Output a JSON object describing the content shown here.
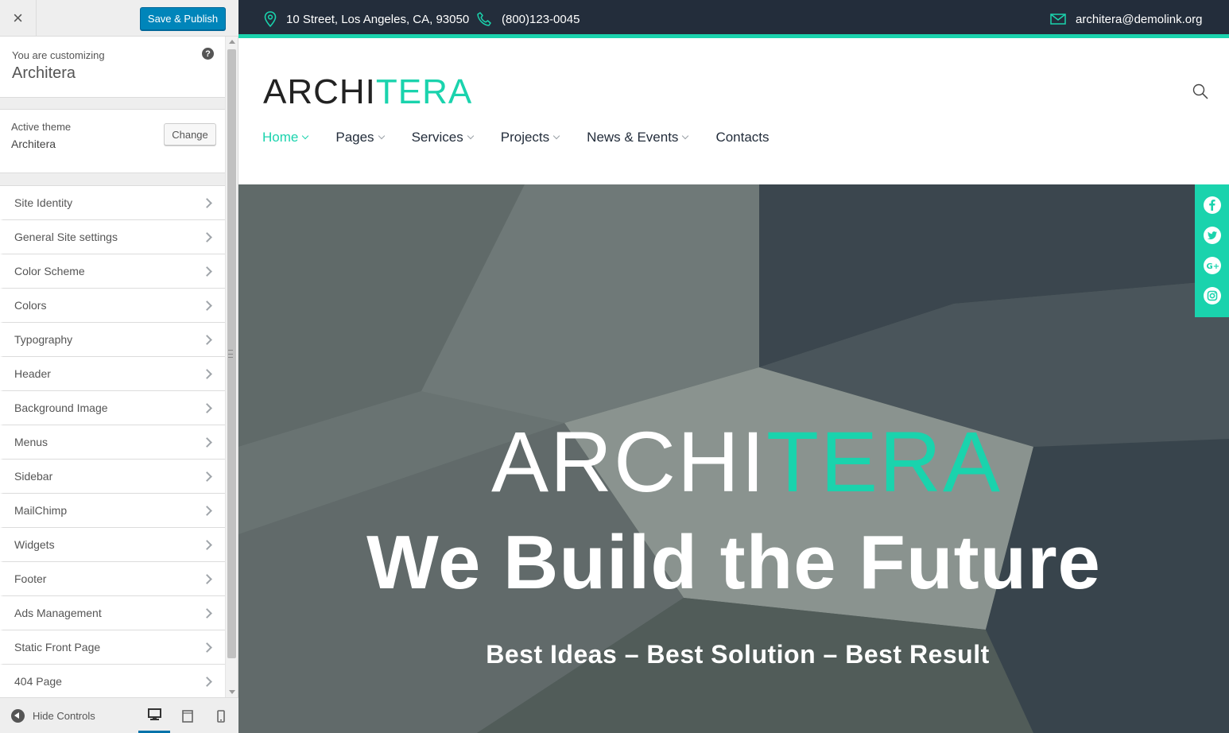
{
  "customizer": {
    "close_label": "×",
    "publish_label": "Save & Publish",
    "customizing_label": "You are customizing",
    "site_name": "Architera",
    "help_label": "?",
    "active_theme_label": "Active theme",
    "active_theme_name": "Architera",
    "change_label": "Change",
    "panels": [
      {
        "label": "Site Identity"
      },
      {
        "label": "General Site settings"
      },
      {
        "label": "Color Scheme"
      },
      {
        "label": "Colors"
      },
      {
        "label": "Typography"
      },
      {
        "label": "Header"
      },
      {
        "label": "Background Image"
      },
      {
        "label": "Menus"
      },
      {
        "label": "Sidebar"
      },
      {
        "label": "MailChimp"
      },
      {
        "label": "Widgets"
      },
      {
        "label": "Footer"
      },
      {
        "label": "Ads Management"
      },
      {
        "label": "Static Front Page"
      },
      {
        "label": "404 Page"
      }
    ],
    "footer": {
      "hide_controls_label": "Hide Controls",
      "devices": [
        {
          "name": "desktop",
          "active": true
        },
        {
          "name": "tablet",
          "active": false
        },
        {
          "name": "mobile",
          "active": false
        }
      ]
    }
  },
  "site": {
    "topbar": {
      "address": "10 Street, Los Angeles, CA, 93050",
      "phone": "(800)123-0045",
      "email": "architera@demolink.org"
    },
    "logo": {
      "part1": "ARCHI",
      "part2": "TERA"
    },
    "nav": [
      {
        "label": "Home",
        "active": true,
        "has_dropdown": true
      },
      {
        "label": "Pages",
        "active": false,
        "has_dropdown": true
      },
      {
        "label": "Services",
        "active": false,
        "has_dropdown": true
      },
      {
        "label": "Projects",
        "active": false,
        "has_dropdown": true
      },
      {
        "label": "News & Events",
        "active": false,
        "has_dropdown": true
      },
      {
        "label": "Contacts",
        "active": false,
        "has_dropdown": false
      }
    ],
    "hero": {
      "logo_part1": "ARCHI",
      "logo_part2": "TERA",
      "title": "We Build the Future",
      "subtitle": "Best Ideas – Best Solution – Best Result"
    },
    "social": [
      "facebook-icon",
      "twitter-icon",
      "google-plus-icon",
      "instagram-icon"
    ]
  },
  "colors": {
    "accent": "#1ad3ad",
    "topbar_bg": "#232d3b",
    "publish_blue": "#0085ba",
    "sidebar_bg": "#eeeeee"
  }
}
